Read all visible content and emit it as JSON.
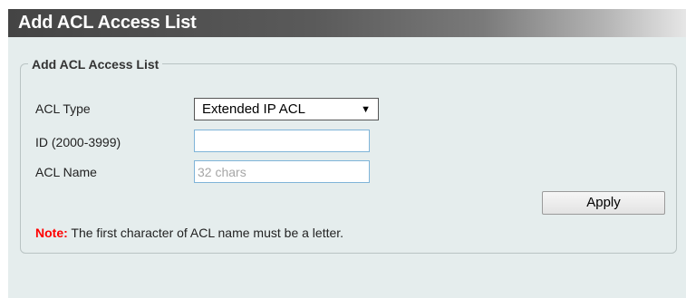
{
  "header": {
    "title": "Add ACL Access List"
  },
  "form": {
    "legend": "Add ACL Access List",
    "acl_type": {
      "label": "ACL Type",
      "value": "Extended IP ACL",
      "arrow": "▼"
    },
    "id_field": {
      "label": "ID (2000-3999)",
      "value": "",
      "placeholder": ""
    },
    "acl_name": {
      "label": "ACL Name",
      "value": "",
      "placeholder": "32 chars"
    },
    "apply_label": "Apply"
  },
  "note": {
    "label": "Note:",
    "text": " The first character of ACL name must be a letter."
  },
  "colors": {
    "note_label": "#ff0000",
    "content_background": "#e5eded",
    "input_border": "#7fb4d8"
  }
}
